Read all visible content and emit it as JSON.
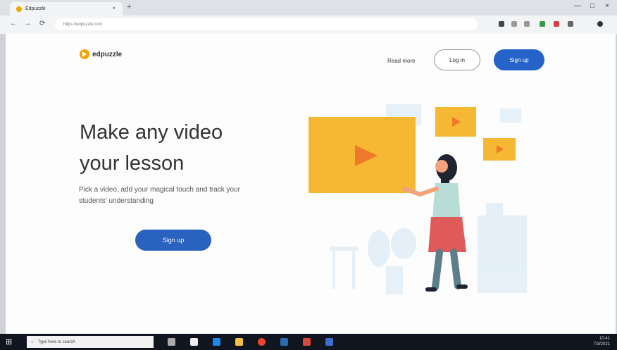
{
  "browser": {
    "tab_title": "Edpuzzle",
    "tab_close": "×",
    "new_tab": "+",
    "window_controls": [
      "—",
      "□",
      "×"
    ],
    "nav": {
      "back": "←",
      "forward": "→",
      "reload": "⟳"
    },
    "address": "https://edpuzzle.com"
  },
  "site": {
    "logo_text": "edpuzzle",
    "read_more": "Read more",
    "login_label": "Log in",
    "signup_label": "Sign up",
    "headline_line1": "Make any video",
    "headline_line2": "your lesson",
    "subtext": "Pick a video, add your magical touch and track your students' understanding",
    "hero_signup_label": "Sign up"
  },
  "taskbar": {
    "search_placeholder": "Type here to search",
    "time": "10:41",
    "date": "7/3/2021"
  },
  "colors": {
    "brand_orange": "#f5a400",
    "primary_blue": "#2563c9",
    "video_yellow": "#f6b833",
    "play_orange": "#f0782a"
  }
}
